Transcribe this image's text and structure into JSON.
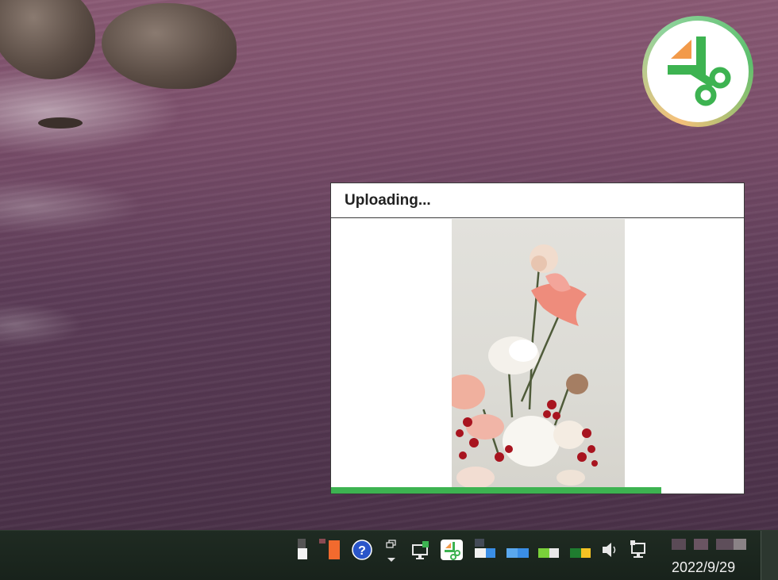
{
  "upload_dialog": {
    "title": "Uploading...",
    "progress": 0.8
  },
  "taskbar": {
    "clock_date": "2022/9/29",
    "tray_icons": [
      "help-icon",
      "window-switch-icon",
      "network-icon",
      "app-tray-icon",
      "volume-icon",
      "display-icon"
    ]
  },
  "colors": {
    "progress": "#3db351",
    "brand_green": "#3db351",
    "brand_orange": "#f29a4a"
  }
}
